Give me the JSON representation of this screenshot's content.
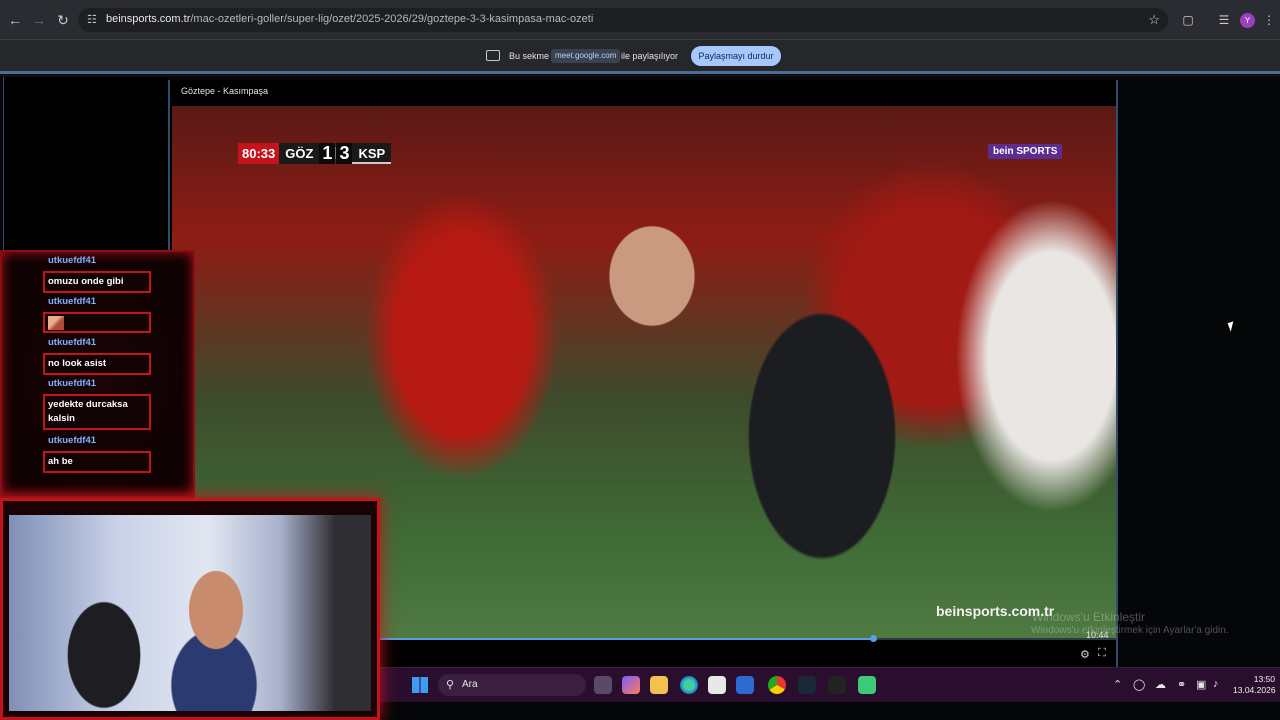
{
  "browser": {
    "url_domain": "beinsports.com.tr",
    "url_path": "/mac-ozetleri-goller/super-lig/ozet/2025-2026/29/goztepe-3-3-kasimpasa-mac-ozeti",
    "profile_initial": "Y"
  },
  "sharebar": {
    "text_before": "Bu sekme",
    "domain_chip": "meet.google.com",
    "text_after": "ile paylaşılıyor",
    "stop_button": "Paylaşmayı durdur"
  },
  "player": {
    "title": "Göztepe - Kasımpaşa",
    "time_label": "10:44",
    "progress_fraction": 0.67,
    "scoreboard": {
      "clock": "80:33",
      "home_team": "GÖZ",
      "home_score": "1",
      "away_score": "3",
      "away_team": "KSP"
    },
    "broadcaster_logo": "bein SPORTS",
    "broadcaster_url": "beinsports.com.tr"
  },
  "watermark": {
    "line1": "Windows'u Etkinleştir",
    "line2": "Windows'u etkinleştirmek için Ayarlar'a gidin."
  },
  "chat": {
    "messages": [
      {
        "user": "utkuefdf41",
        "text": "omuzu onde gibi"
      },
      {
        "user": "utkuefdf41",
        "text": ""
      },
      {
        "user": "utkuefdf41",
        "text": "no look asist"
      },
      {
        "user": "utkuefdf41",
        "text": "yedekte durcaksa kalsin"
      },
      {
        "user": "utkuefdf41",
        "text": "ah be"
      }
    ]
  },
  "taskbar": {
    "search_placeholder": "Ara",
    "time": "13:50",
    "date": "13.04.2026"
  },
  "colors": {
    "accent": "#a8c7fa",
    "chat_border": "#c3141c",
    "chat_username": "#7fb0ff",
    "score_clock_bg": "#c4131d"
  }
}
